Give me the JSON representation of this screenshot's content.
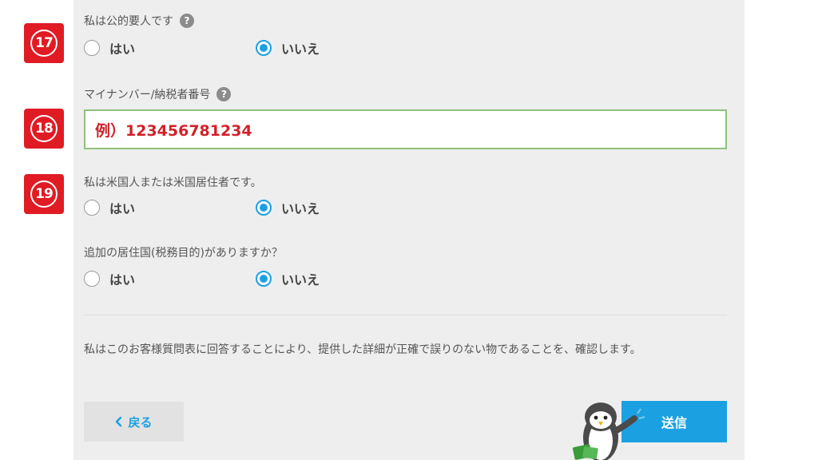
{
  "badges": {
    "q17": "17",
    "q18": "18",
    "q19": "19"
  },
  "public_official": {
    "label": "私は公的要人です",
    "help_icon": "question-circle-icon",
    "yes": "はい",
    "no": "いいえ",
    "selected": "no"
  },
  "tax_number": {
    "label": "マイナンバー/納税者番号",
    "help_icon": "question-circle-icon",
    "value": "例）123456781234"
  },
  "us_person": {
    "label": "私は米国人または米国居住者です。",
    "yes": "はい",
    "no": "いいえ",
    "selected": "no"
  },
  "additional_residence": {
    "label": "追加の居住国(税務目的)がありますか？",
    "yes": "はい",
    "no": "いいえ",
    "selected": "no"
  },
  "confirmation_text": "私はこのお客様質問表に回答することにより、提供した詳細が正確で誤りのない物であることを、確認します。",
  "buttons": {
    "back": "戻る",
    "back_icon": "chevron-left-icon",
    "send": "送信"
  },
  "colors": {
    "accent": "#1ba1e2",
    "badge": "#e01b23",
    "field_border": "#8fc17a",
    "field_text": "#d0222a",
    "panel": "#eeeeee"
  }
}
